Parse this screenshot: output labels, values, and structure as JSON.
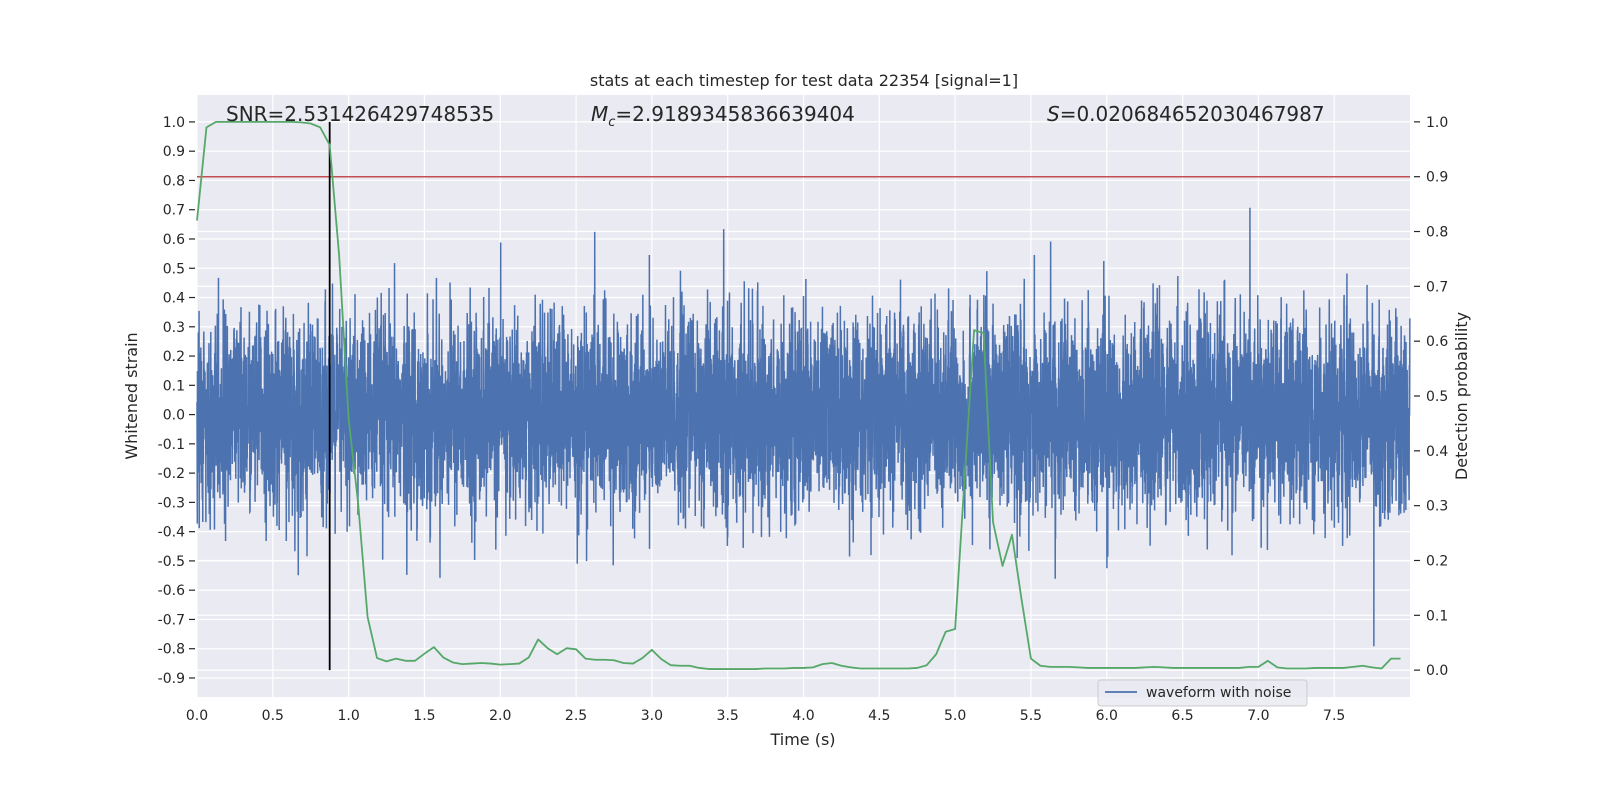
{
  "chart_data": {
    "type": "line",
    "title": "stats at each timestep for test data 22354 [signal=1]",
    "xlabel": "Time (s)",
    "ylabel": "Whitened strain",
    "ylabel_right": "Detection probability",
    "xlim": [
      0,
      8
    ],
    "ylim": [
      -0.965,
      1.092
    ],
    "ylim_right": [
      -0.049,
      1.049
    ],
    "grid": true,
    "background": "#eaeaf2",
    "x_ticks": [
      "0.0",
      "0.5",
      "1.0",
      "1.5",
      "2.0",
      "2.5",
      "3.0",
      "3.5",
      "4.0",
      "4.5",
      "5.0",
      "5.5",
      "6.0",
      "6.5",
      "7.0",
      "7.5"
    ],
    "y_ticks": [
      "-0.9",
      "-0.8",
      "-0.7",
      "-0.6",
      "-0.5",
      "-0.4",
      "-0.3",
      "-0.2",
      "-0.1",
      "0.0",
      "0.1",
      "0.2",
      "0.3",
      "0.4",
      "0.5",
      "0.6",
      "0.7",
      "0.8",
      "0.9",
      "1.0"
    ],
    "y_right_ticks": [
      "0.0",
      "0.1",
      "0.2",
      "0.3",
      "0.4",
      "0.5",
      "0.6",
      "0.7",
      "0.8",
      "0.9",
      "1.0"
    ],
    "annotations": {
      "snr": {
        "text": "SNR=2.531426429748535"
      },
      "mc": {
        "symbol": "M",
        "subscript": "c",
        "value": "=2.9189345836639404"
      },
      "s": {
        "symbol": "S",
        "value": "=0.020684652030467987"
      }
    },
    "legend": {
      "placement": "lower-right",
      "entries": [
        "waveform with noise"
      ]
    },
    "series": [
      {
        "name": "waveform with noise",
        "color": "#4c72b0",
        "axis": "left",
        "kind": "noisy strain"
      },
      {
        "color": "#55a868",
        "axis": "right",
        "x": [
          0,
          0.0625,
          0.125,
          0.1875,
          0.25,
          0.3125,
          0.375,
          0.4375,
          0.5,
          0.5625,
          0.625,
          0.6875,
          0.75,
          0.8125,
          0.875,
          0.9375,
          1,
          1.0625,
          1.125,
          1.1875,
          1.25,
          1.3125,
          1.375,
          1.4375,
          1.5,
          1.5625,
          1.625,
          1.6875,
          1.75,
          1.8125,
          1.875,
          1.9375,
          2,
          2.0625,
          2.125,
          2.1875,
          2.25,
          2.3125,
          2.375,
          2.4375,
          2.5,
          2.5625,
          2.625,
          2.6875,
          2.75,
          2.8125,
          2.875,
          2.9375,
          3,
          3.0625,
          3.125,
          3.1875,
          3.25,
          3.3125,
          3.375,
          3.4375,
          3.5,
          3.5625,
          3.625,
          3.6875,
          3.75,
          3.8125,
          3.875,
          3.9375,
          4,
          4.0625,
          4.125,
          4.1875,
          4.25,
          4.3125,
          4.375,
          4.4375,
          4.5,
          4.5625,
          4.625,
          4.6875,
          4.75,
          4.8125,
          4.875,
          4.9375,
          5,
          5.0625,
          5.125,
          5.1875,
          5.25,
          5.3125,
          5.375,
          5.4375,
          5.5,
          5.5625,
          5.625,
          5.6875,
          5.75,
          5.8125,
          5.875,
          5.9375,
          6,
          6.0625,
          6.125,
          6.1875,
          6.25,
          6.3125,
          6.375,
          6.4375,
          6.5,
          6.5625,
          6.625,
          6.6875,
          6.75,
          6.8125,
          6.875,
          6.9375,
          7,
          7.0625,
          7.125,
          7.1875,
          7.25,
          7.3125,
          7.375,
          7.4375,
          7.5,
          7.5625,
          7.625,
          7.6875,
          7.75,
          7.8125,
          7.875,
          7.9375
        ],
        "y": [
          0.82,
          0.99,
          1,
          1,
          1,
          1,
          1,
          1,
          1,
          1,
          1,
          0.999,
          0.997,
          0.99,
          0.958,
          0.756,
          0.458,
          0.305,
          0.097,
          0.022,
          0.016,
          0.021,
          0.017,
          0.017,
          0.03,
          0.042,
          0.023,
          0.014,
          0.011,
          0.012,
          0.013,
          0.012,
          0.01,
          0.011,
          0.012,
          0.023,
          0.056,
          0.04,
          0.029,
          0.04,
          0.038,
          0.021,
          0.019,
          0.019,
          0.018,
          0.013,
          0.012,
          0.022,
          0.037,
          0.02,
          0.009,
          0.008,
          0.008,
          0.004,
          0.002,
          0.002,
          0.002,
          0.002,
          0.002,
          0.002,
          0.003,
          0.003,
          0.003,
          0.004,
          0.004,
          0.005,
          0.011,
          0.013,
          0.008,
          0.005,
          0.003,
          0.003,
          0.003,
          0.003,
          0.003,
          0.003,
          0.004,
          0.009,
          0.029,
          0.07,
          0.075,
          0.35,
          0.62,
          0.615,
          0.27,
          0.19,
          0.247,
          0.13,
          0.021,
          0.008,
          0.006,
          0.006,
          0.006,
          0.005,
          0.004,
          0.004,
          0.004,
          0.004,
          0.004,
          0.004,
          0.005,
          0.006,
          0.005,
          0.004,
          0.004,
          0.004,
          0.004,
          0.004,
          0.004,
          0.004,
          0.004,
          0.006,
          0.006,
          0.017,
          0.005,
          0.003,
          0.003,
          0.003,
          0.004,
          0.004,
          0.004,
          0.004,
          0.006,
          0.008,
          0.005,
          0.003,
          0.021,
          0.021
        ]
      }
    ],
    "hlines": [
      {
        "y": 0.9,
        "axis": "right",
        "color": "#c44e52"
      }
    ],
    "vlines": [
      {
        "x": 0.875,
        "color": "#000000"
      }
    ]
  }
}
